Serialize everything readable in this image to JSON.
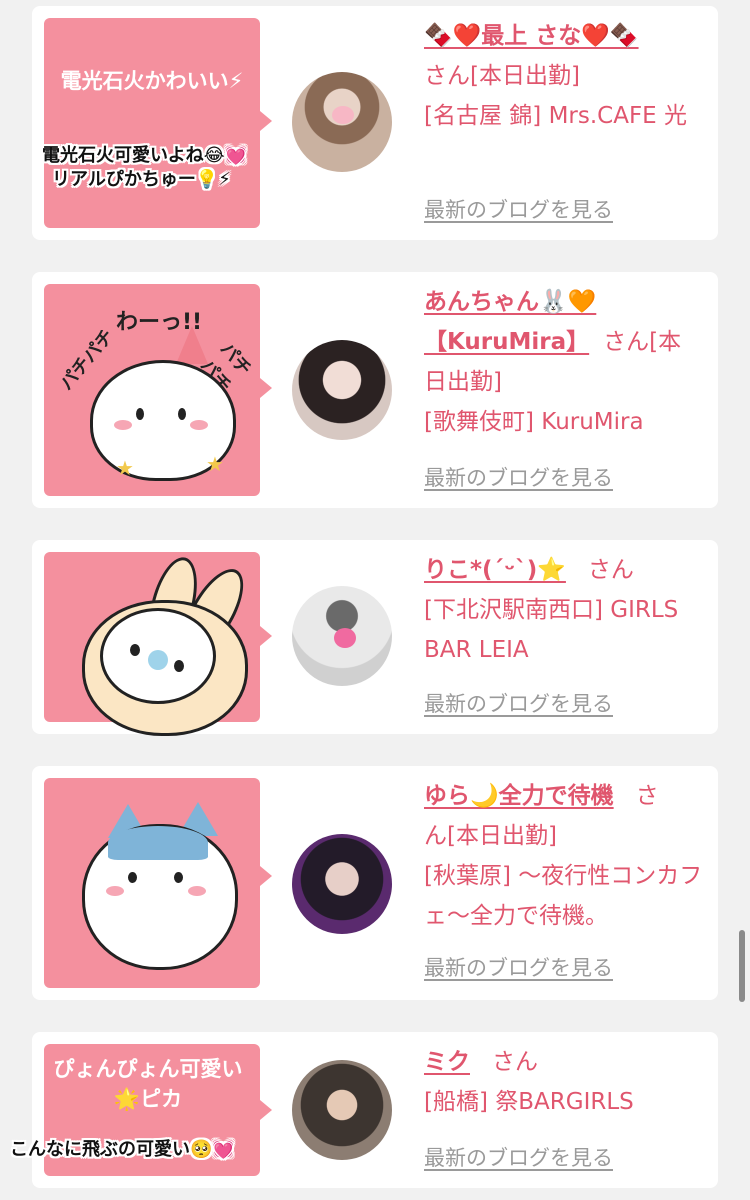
{
  "posts": [
    {
      "name": "🍫❤️最上 さな❤️🍫",
      "san": "さん[本日出勤]",
      "shop": "[名古屋 錦] Mrs.CAFE 光",
      "blog_link": "最新のブログを見る",
      "bubble_text": "電光石火かわいい⚡",
      "caption_lines": [
        "電光石火可愛いよね😂💓",
        "リアルぴかちゅー💡⚡"
      ]
    },
    {
      "name_line1": "あんちゃん🐰🧡",
      "name_line2": "【KuruMira】",
      "san_line1": "さん[本",
      "san_line2": "日出勤]",
      "shop": "[歌舞伎町] KuruMira",
      "blog_link": "最新のブログを見る",
      "sticker_text": [
        "パチパチ",
        "わーっ!!",
        "パチパチ"
      ]
    },
    {
      "name": "りこ*(ˊᵕˋ)⭐",
      "san": "さん",
      "shop": "[下北沢駅南西口] GIRLS BAR LEIA",
      "blog_link": "最新のブログを見る"
    },
    {
      "name": "ゆら🌙全力で待機",
      "san_line1": "さ",
      "san_line2": "ん[本日出勤]",
      "shop": "[秋葉原] 〜夜行性コンカフェ〜全力で待機。",
      "blog_link": "最新のブログを見る"
    },
    {
      "name": "ミク",
      "san": "さん",
      "shop": "[船橋] 祭BARGIRLS",
      "blog_link": "最新のブログを見る",
      "bubble_text": "ぴょんぴょん可愛い🌟ピカ",
      "caption": "こんなに飛ぶの可愛い🥺💓"
    }
  ],
  "colors": {
    "accent": "#e0566e",
    "bubble": "#f4909e",
    "link_gray": "#9a9a9a",
    "background": "#f1f1f1"
  }
}
